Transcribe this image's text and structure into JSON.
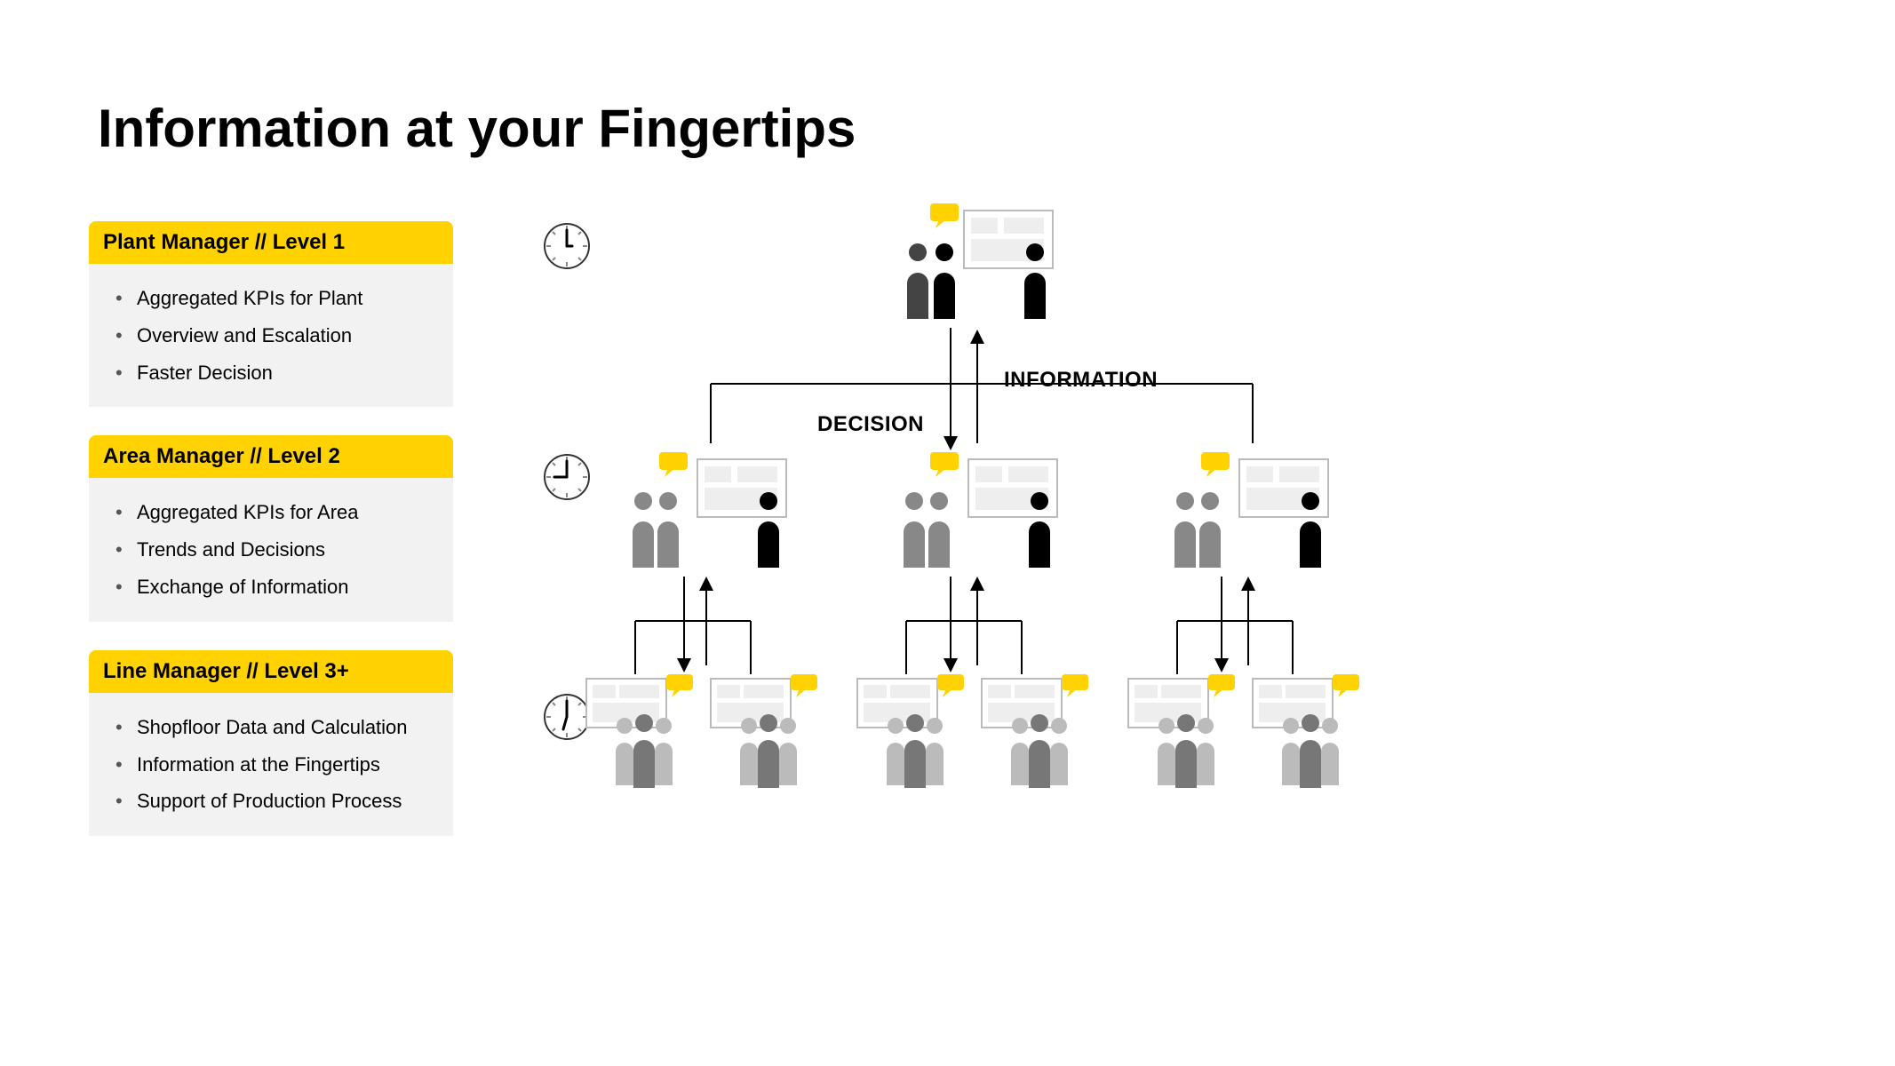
{
  "title": "Information at your Fingertips",
  "labels": {
    "decision": "DECISION",
    "information": "INFORMATION"
  },
  "levels": [
    {
      "header": "Plant Manager // Level 1",
      "bullets": [
        "Aggregated KPIs for Plant",
        "Overview and Escalation",
        "Faster Decision"
      ]
    },
    {
      "header": "Area Manager // Level 2",
      "bullets": [
        "Aggregated KPIs for Area",
        "Trends and Decisions",
        "Exchange of Information"
      ]
    },
    {
      "header": "Line Manager // Level 3+",
      "bullets": [
        "Shopfloor Data and Calculation",
        "Information at the Fingertips",
        "Support of Production Process"
      ]
    }
  ]
}
